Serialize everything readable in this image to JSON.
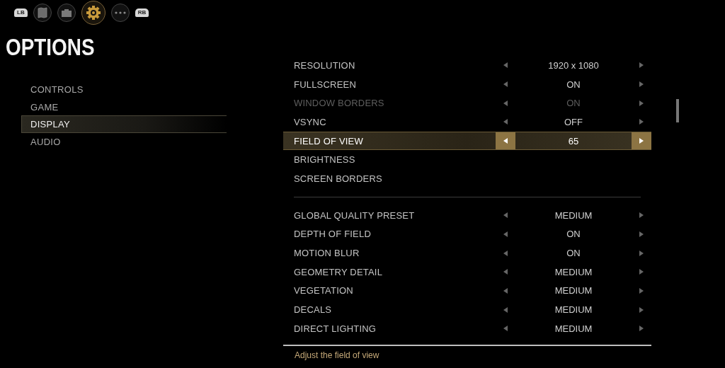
{
  "top_bar": {
    "left_bumper": "LB",
    "right_bumper": "RB",
    "tabs": [
      {
        "kind": "map",
        "selected": false
      },
      {
        "kind": "briefcase",
        "selected": false
      },
      {
        "kind": "gear",
        "selected": true
      },
      {
        "kind": "more",
        "selected": false
      }
    ]
  },
  "title": "OPTIONS",
  "sidebar": {
    "items": [
      {
        "label": "CONTROLS",
        "selected": false
      },
      {
        "label": "GAME",
        "selected": false
      },
      {
        "label": "DISPLAY",
        "selected": true
      },
      {
        "label": "AUDIO",
        "selected": false
      }
    ]
  },
  "settings": {
    "groups": [
      {
        "rows": [
          {
            "kind": "selector",
            "label": "RESOLUTION",
            "value": "1920 x 1080",
            "selected": false,
            "disabled": false
          },
          {
            "kind": "selector",
            "label": "FULLSCREEN",
            "value": "ON",
            "selected": false,
            "disabled": false
          },
          {
            "kind": "selector",
            "label": "WINDOW BORDERS",
            "value": "ON",
            "selected": false,
            "disabled": true
          },
          {
            "kind": "selector",
            "label": "VSYNC",
            "value": "OFF",
            "selected": false,
            "disabled": false
          },
          {
            "kind": "selector",
            "label": "FIELD OF VIEW",
            "value": "65",
            "selected": true,
            "disabled": false
          },
          {
            "kind": "link",
            "label": "BRIGHTNESS",
            "selected": false,
            "disabled": false
          },
          {
            "kind": "link",
            "label": "SCREEN BORDERS",
            "selected": false,
            "disabled": false
          }
        ]
      },
      {
        "rows": [
          {
            "kind": "selector",
            "label": "GLOBAL QUALITY PRESET",
            "value": "MEDIUM",
            "selected": false,
            "disabled": false
          },
          {
            "kind": "selector",
            "label": "DEPTH OF FIELD",
            "value": "ON",
            "selected": false,
            "disabled": false
          },
          {
            "kind": "selector",
            "label": "MOTION BLUR",
            "value": "ON",
            "selected": false,
            "disabled": false
          },
          {
            "kind": "selector",
            "label": "GEOMETRY DETAIL",
            "value": "MEDIUM",
            "selected": false,
            "disabled": false
          },
          {
            "kind": "selector",
            "label": "VEGETATION",
            "value": "MEDIUM",
            "selected": false,
            "disabled": false
          },
          {
            "kind": "selector",
            "label": "DECALS",
            "value": "MEDIUM",
            "selected": false,
            "disabled": false
          },
          {
            "kind": "selector",
            "label": "DIRECT LIGHTING",
            "value": "MEDIUM",
            "selected": false,
            "disabled": false
          }
        ]
      }
    ]
  },
  "hint": "Adjust the field of view"
}
